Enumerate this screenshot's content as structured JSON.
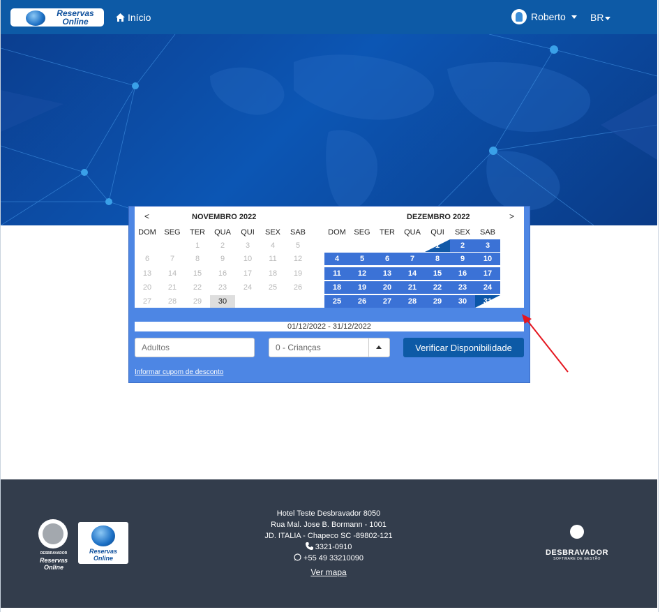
{
  "navbar": {
    "logo_line1": "Reservas",
    "logo_line2": "Online",
    "home_label": "Início",
    "user_name": "Roberto",
    "language": "BR"
  },
  "calendar": {
    "left": {
      "prev_arrow": "<",
      "title": "NOVEMBRO 2022",
      "weekdays": [
        "DOM",
        "SEG",
        "TER",
        "QUA",
        "QUI",
        "SEX",
        "SAB"
      ],
      "rows": [
        [
          "",
          "",
          "1",
          "2",
          "3",
          "4",
          "5"
        ],
        [
          "6",
          "7",
          "8",
          "9",
          "10",
          "11",
          "12"
        ],
        [
          "13",
          "14",
          "15",
          "16",
          "17",
          "18",
          "19"
        ],
        [
          "20",
          "21",
          "22",
          "23",
          "24",
          "25",
          "26"
        ],
        [
          "27",
          "28",
          "29",
          "30",
          "",
          "",
          ""
        ]
      ],
      "highlighted_day": "30"
    },
    "right": {
      "next_arrow": ">",
      "title": "DEZEMBRO 2022",
      "weekdays": [
        "DOM",
        "SEG",
        "TER",
        "QUA",
        "QUI",
        "SEX",
        "SAB"
      ],
      "rows": [
        [
          "",
          "",
          "",
          "",
          "1",
          "2",
          "3"
        ],
        [
          "4",
          "5",
          "6",
          "7",
          "8",
          "9",
          "10"
        ],
        [
          "11",
          "12",
          "13",
          "14",
          "15",
          "16",
          "17"
        ],
        [
          "18",
          "19",
          "20",
          "21",
          "22",
          "23",
          "24"
        ],
        [
          "25",
          "26",
          "27",
          "28",
          "29",
          "30",
          "31"
        ]
      ],
      "range_start": "1",
      "range_end": "31"
    }
  },
  "booking": {
    "date_range": "01/12/2022 - 31/12/2022",
    "adults_placeholder": "Adultos",
    "children_value": "0 - Crianças",
    "verify_button": "Verificar Disponibilidade",
    "coupon_link": "Informar cupom de desconto"
  },
  "footer": {
    "logo_small_line1": "DESBRAVADOR",
    "logo_small_line2": "Reservas",
    "logo_small_line3": "Online",
    "logo2_line1": "Reservas",
    "logo2_line2": "Online",
    "hotel_name": "Hotel Teste Desbravador 8050",
    "address_line1": "Rua Mal. Jose B. Bormann - 1001",
    "address_line2": "JD. ITALIA - Chapeco SC -89802-121",
    "phone": "3321-0910",
    "whatsapp": "+55 49 33210090",
    "map_link": "Ver mapa",
    "brand_name": "DESBRAVADOR",
    "brand_tagline": "SOFTWARE DE GESTÃO"
  },
  "colors": {
    "navbar": "#0d5aa6",
    "widget": "#4d86e4",
    "selected_day": "#3b72d6",
    "footer": "#333d4c",
    "annotation_arrow": "#e5161f"
  }
}
